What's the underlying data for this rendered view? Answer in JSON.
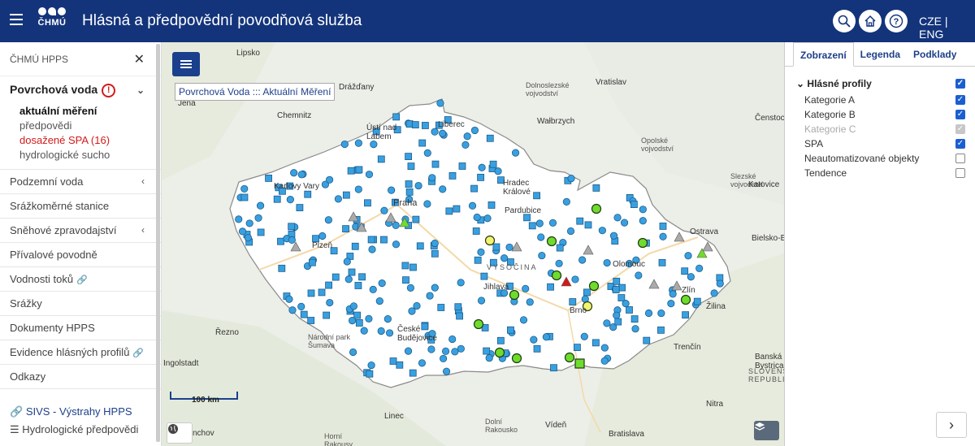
{
  "header": {
    "logo_text": "ČHMÚ",
    "title": "Hlásná a předpovědní povodňová služba",
    "lang": "CZE | ENG",
    "icons": [
      "search-icon",
      "home-icon",
      "help-icon"
    ]
  },
  "sidebar": {
    "head": "ČHMÚ HPPS",
    "open_section": {
      "label": "Povrchová voda",
      "badge": "!",
      "items": [
        "aktuální měření",
        "předpovědi",
        "dosažené SPA (16)",
        "hydrologické sucho"
      ]
    },
    "items": [
      {
        "label": "Podzemní voda",
        "icon": "chevron-left"
      },
      {
        "label": "Srážkoměrné stanice",
        "icon": ""
      },
      {
        "label": "Sněhové zpravodajství",
        "icon": "chevron-left"
      },
      {
        "label": "Přívalové povodně",
        "icon": ""
      },
      {
        "label": "Vodnosti toků",
        "icon": "link"
      },
      {
        "label": "Srážky",
        "icon": ""
      },
      {
        "label": "Dokumenty HPPS",
        "icon": ""
      },
      {
        "label": "Evidence hlásných profilů",
        "icon": "link"
      },
      {
        "label": "Odkazy",
        "icon": ""
      }
    ],
    "links": [
      "SIVS - Výstrahy HPPS",
      "Hydrologické předpovědi"
    ]
  },
  "map": {
    "layer_tooltip": "Povrchová Voda ::: Aktuální Měření",
    "scale_label": "100 km",
    "labels": {
      "lipsko": "Lipsko",
      "drazdany": "Drážďany",
      "jena": "Jena",
      "chemnitz": "Chemnitz",
      "liberec": "Liberec",
      "walbrzych": "Wałbrzych",
      "vratislav": "Vratislav",
      "dolnoslezske": "Dolnoslezské vojvodství",
      "opolske": "Opolské vojvodství",
      "slezske": "Slezské vojvodství",
      "cestochov": "Čenstochov",
      "katovice": "Katovice",
      "karlovyvary": "Karlovy Vary",
      "usti": "Ústí nad Labem",
      "praha": "Praha",
      "hradec": "Hradec Králové",
      "pardubice": "Pardubice",
      "plzen": "Plzeň",
      "jihlava": "Jihlava",
      "olomouc": "Olomouc",
      "ostrava": "Ostrava",
      "bielsko": "Bielsko-Biała",
      "brno": "Brno",
      "zlin": "Zlín",
      "zilina": "Žilina",
      "budejovice": "České Budějovice",
      "sumava": "Národní park Šumava",
      "rezno": "Řezno",
      "ingolstadt": "Ingolstadt",
      "trencin": "Trenčín",
      "bystrica": "Banská Bystrica",
      "slovenska": "SLOVENSKÁ REPUBLIKA",
      "linec": "Linec",
      "dolni": "Dolní Rakousko",
      "viden": "Vídeň",
      "bratislava": "Bratislava",
      "nitra": "Nitra",
      "horni": "Horní Rakousy",
      "mnichov": "nchov",
      "vysocina": "VYSOČINA"
    }
  },
  "panel": {
    "tabs": [
      "Zobrazení",
      "Legenda",
      "Podklady"
    ],
    "group": "Hlásné profily",
    "rows": [
      {
        "label": "Kategorie A",
        "state": "on"
      },
      {
        "label": "Kategorie B",
        "state": "on"
      },
      {
        "label": "Kategorie C",
        "state": "disabled"
      },
      {
        "label": "SPA",
        "state": "on"
      },
      {
        "label": "Neautomatizované objekty",
        "state": "off"
      },
      {
        "label": "Tendence",
        "state": "off"
      }
    ]
  },
  "colors": {
    "header_bg": "#13347b",
    "marker_blue": "#39a0e0",
    "spa_green": "#6edc2c",
    "spa_yellow": "#f5f270",
    "red_alert": "#d21b1b"
  }
}
